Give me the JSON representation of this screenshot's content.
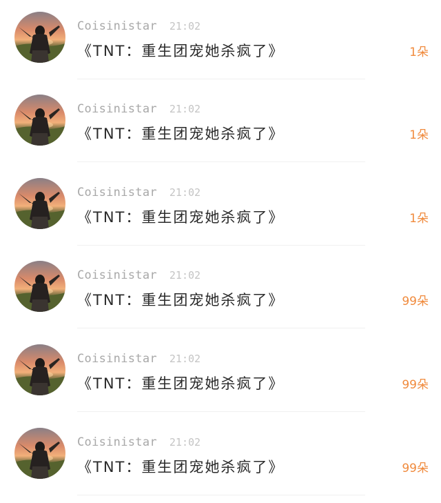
{
  "feed": {
    "items": [
      {
        "username": "Coisinistar",
        "time": "21:02",
        "title": "《TNT：重生团宠她杀疯了》",
        "count": "1朵",
        "avatar_icon": "avatar-girl-sunset-icon"
      },
      {
        "username": "Coisinistar",
        "time": "21:02",
        "title": "《TNT：重生团宠她杀疯了》",
        "count": "1朵",
        "avatar_icon": "avatar-girl-sunset-icon"
      },
      {
        "username": "Coisinistar",
        "time": "21:02",
        "title": "《TNT：重生团宠她杀疯了》",
        "count": "1朵",
        "avatar_icon": "avatar-girl-sunset-icon"
      },
      {
        "username": "Coisinistar",
        "time": "21:02",
        "title": "《TNT：重生团宠她杀疯了》",
        "count": "99朵",
        "avatar_icon": "avatar-girl-sunset-icon"
      },
      {
        "username": "Coisinistar",
        "time": "21:02",
        "title": "《TNT：重生团宠她杀疯了》",
        "count": "99朵",
        "avatar_icon": "avatar-girl-sunset-icon"
      },
      {
        "username": "Coisinistar",
        "time": "21:02",
        "title": "《TNT：重生团宠她杀疯了》",
        "count": "99朵",
        "avatar_icon": "avatar-girl-sunset-icon"
      }
    ]
  },
  "colors": {
    "count": "#f08a3c",
    "username": "#a8a8a8",
    "time": "#c4c4c4",
    "title": "#2a2a2a",
    "divider": "#f0f0f0"
  }
}
